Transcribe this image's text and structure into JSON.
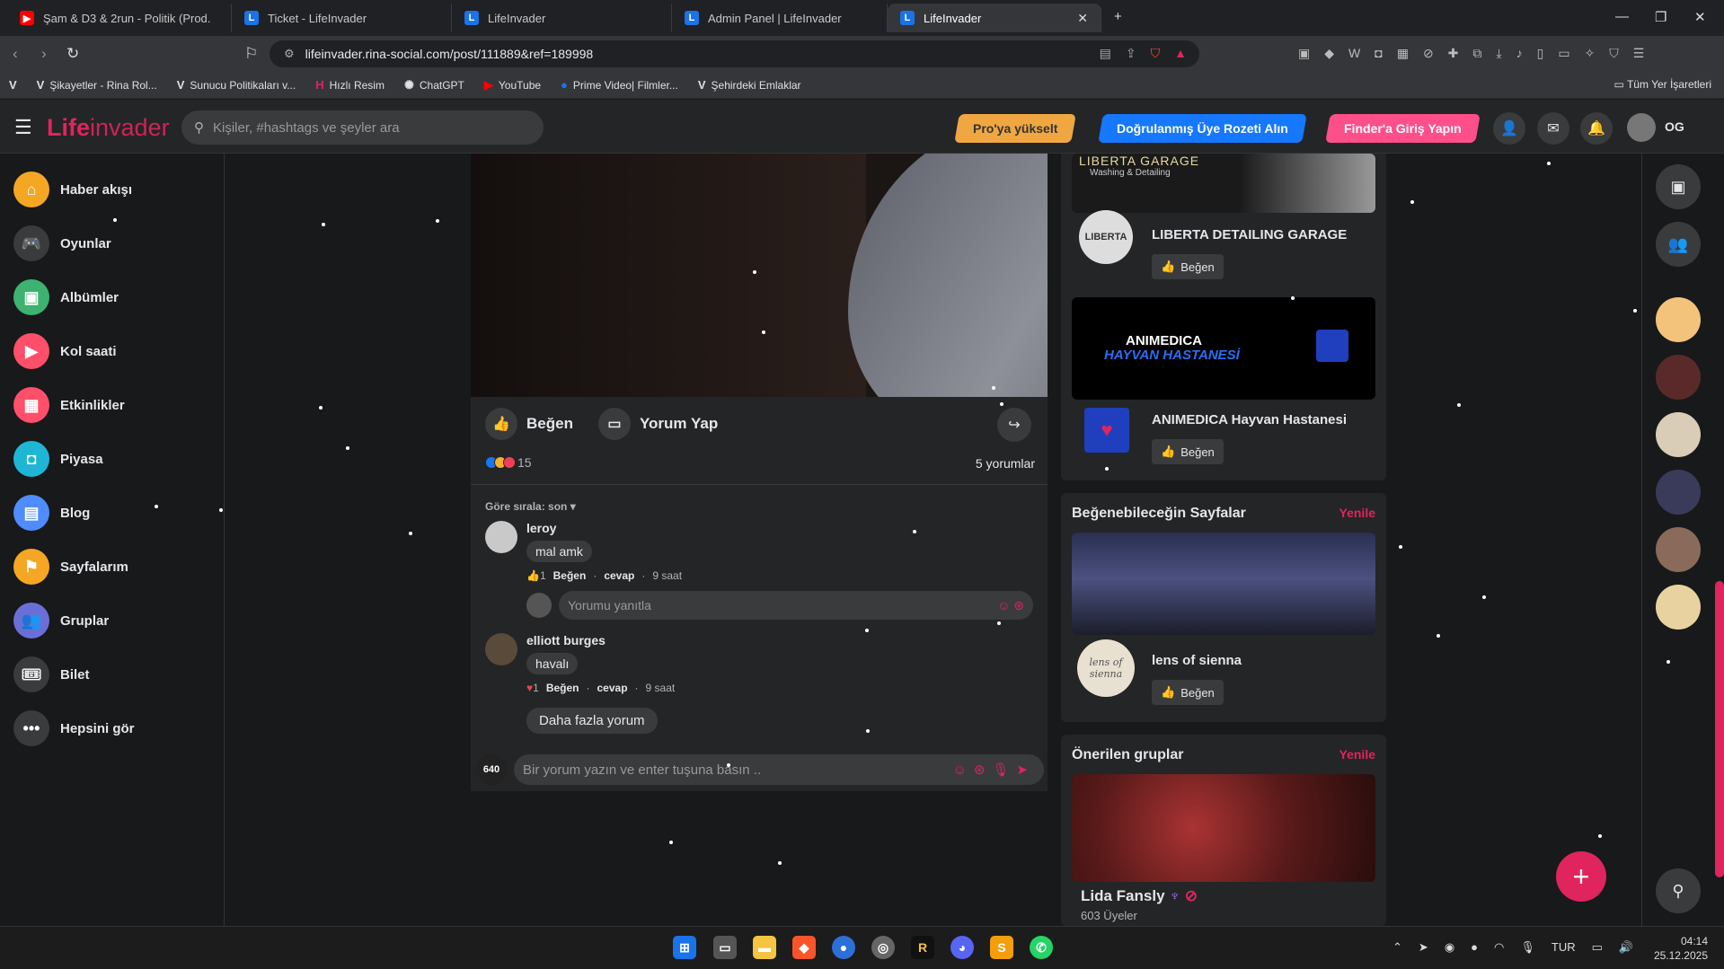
{
  "browser": {
    "tabs": [
      {
        "title": "Şam & D3 & 2run - Politik (Prod.",
        "icon": "youtube-icon"
      },
      {
        "title": "Ticket - LifeInvader",
        "icon": "lifeinvader-icon"
      },
      {
        "title": "LifeInvader",
        "icon": "lifeinvader-icon"
      },
      {
        "title": "Admin Panel | LifeInvader",
        "icon": "lifeinvader-icon"
      },
      {
        "title": "LifeInvader",
        "icon": "lifeinvader-icon",
        "active": true
      }
    ],
    "url": "lifeinvader.rina-social.com/post/111889&ref=189998",
    "bookmarks": [
      "Şikayetler - Rina Rol...",
      "Sunucu Politikaları v...",
      "Hızlı Resim",
      "ChatGPT",
      "YouTube",
      "Prime Video| Filmler...",
      "Şehirdeki Emlaklar"
    ],
    "all_bookmarks": "Tüm Yer İşaretleri"
  },
  "header": {
    "logo_bold": "Life",
    "logo_light": "invader",
    "search_placeholder": "Kişiler, #hashtags ve şeyler ara",
    "pro_button": "Pro'ya yükselt",
    "badge_button": "Doğrulanmış Üye Rozeti Alın",
    "finder_button": "Finder'a Giriş Yapın",
    "user_initials": "OG"
  },
  "sidebar": {
    "items": [
      {
        "label": "Haber akışı",
        "icon": "home-icon",
        "color": "#f5a623"
      },
      {
        "label": "Oyunlar",
        "icon": "gamepad-icon",
        "color": "#3a3b3c"
      },
      {
        "label": "Albümler",
        "icon": "album-icon",
        "color": "#3cb371"
      },
      {
        "label": "Kol saati",
        "icon": "watch-icon",
        "color": "#ff4f6b"
      },
      {
        "label": "Etkinlikler",
        "icon": "calendar-icon",
        "color": "#ff4f6b"
      },
      {
        "label": "Piyasa",
        "icon": "market-icon",
        "color": "#1fb6d6"
      },
      {
        "label": "Blog",
        "icon": "blog-icon",
        "color": "#4f8cff"
      },
      {
        "label": "Sayfalarım",
        "icon": "flag-icon",
        "color": "#f5a623"
      },
      {
        "label": "Gruplar",
        "icon": "group-icon",
        "color": "#6a6fd8"
      },
      {
        "label": "Bilet",
        "icon": "ticket-icon",
        "color": "#3a3b3c"
      },
      {
        "label": "Hepsini gör",
        "icon": "more-icon",
        "color": "#3a3b3c"
      }
    ]
  },
  "post": {
    "like_label": "Beğen",
    "comment_label": "Yorum Yap",
    "reaction_count": "15",
    "comment_count": "5 yorumlar",
    "sort_label": "Göre sırala: son ▾",
    "comments": [
      {
        "name": "leroy",
        "text": "mal amk",
        "reactions": "1",
        "like": "Beğen",
        "reply": "cevap",
        "time": "9 saat"
      },
      {
        "name": "elliott burges",
        "text": "havalı",
        "reactions": "1",
        "like": "Beğen",
        "reply": "cevap",
        "time": "9 saat"
      }
    ],
    "reply_placeholder": "Yorumu yanıtla",
    "more_comments": "Daha fazla yorum",
    "compose_badge": "640",
    "compose_placeholder": "Bir yorum yazın ve enter tuşuna basın .."
  },
  "right": {
    "top_pages": [
      {
        "name": "LIBERTA DETAILING GARAGE",
        "banner_text": "LIBERTA GARAGE",
        "banner_sub": "Washing & Detailing",
        "logo_text": "LIBERTA",
        "like": "Beğen"
      },
      {
        "name": "ANIMEDICA Hayvan Hastanesi",
        "banner_text": "ANIMEDICA",
        "banner_sub": "HAYVAN HASTANESİ",
        "like": "Beğen"
      }
    ],
    "suggested_pages_title": "Beğenebileceğin Sayfalar",
    "refresh_label": "Yenile",
    "suggested_page": {
      "name": "lens of sienna",
      "logo_text": "lens of sienna",
      "like": "Beğen"
    },
    "groups_title": "Önerilen gruplar",
    "group": {
      "name": "Lida Fansly",
      "members": "603 Üyeler"
    }
  },
  "taskbar": {
    "lang": "TUR",
    "time": "04:14",
    "date": "25.12.2025"
  }
}
